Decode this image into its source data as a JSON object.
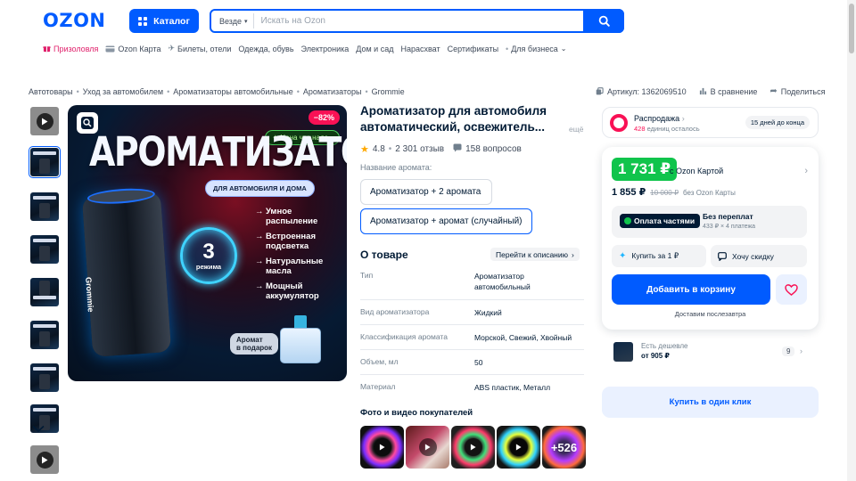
{
  "header": {
    "logo": "OZON",
    "catalog_label": "Каталог",
    "search_scope": "Везде",
    "search_placeholder": "Искать на Ozon"
  },
  "top_nav": [
    {
      "label": "Призоловля",
      "icon": "gift-icon"
    },
    {
      "label": "Ozon Карта",
      "icon": "card-icon"
    },
    {
      "label": "Билеты, отели",
      "icon": "plane-icon"
    },
    {
      "label": "Одежда, обувь"
    },
    {
      "label": "Электроника"
    },
    {
      "label": "Дом и сад"
    },
    {
      "label": "Нарасхват"
    },
    {
      "label": "Сертификаты"
    },
    {
      "label": "Для бизнеса"
    }
  ],
  "breadcrumbs": [
    "Автотовары",
    "Уход за автомобилем",
    "Ароматизаторы автомобильные",
    "Ароматизаторы",
    "Grommie"
  ],
  "product_meta": {
    "article": "Артикул: 1362069510",
    "compare": "В сравнение",
    "share": "Поделиться"
  },
  "gallery": {
    "discount_badge": "−82%",
    "good_price_badge": "Цена что надо",
    "title": "АРОМАТИЗАТОР",
    "usage_pill": "ДЛЯ АВТОМОБИЛЯ И ДОМА",
    "brand_on_device": "Grommie",
    "modes_number": "3",
    "modes_label": "режима",
    "features": [
      "Умное распыление",
      "Встроенная подсветка",
      "Натуральные масла",
      "Мощный аккумулятор"
    ],
    "gift_label": "Аромат\nв подарок"
  },
  "product": {
    "title": "Ароматизатор для автомобиля автоматический, освежитель...",
    "title_more": "ещё",
    "rating": "4.8",
    "reviews": "2 301 отзыв",
    "questions": "158 вопросов",
    "aroma_label": "Название аромата:",
    "options": [
      "Ароматизатор + 2 аромата",
      "Ароматизатор + аромат (случайный)"
    ],
    "selected_option": "Ароматизатор + аромат (случайный)"
  },
  "about": {
    "title": "О товаре",
    "link": "Перейти к описанию",
    "specs": [
      {
        "key": "Тип",
        "value": "Ароматизатор автомобильный"
      },
      {
        "key": "Вид ароматизатора",
        "value": "Жидкий"
      },
      {
        "key": "Классификация аромата",
        "value": "Морской, Свежий, Хвойный"
      },
      {
        "key": "Объем, мл",
        "value": "50"
      },
      {
        "key": "Материал",
        "value": "ABS пластик, Металл"
      }
    ]
  },
  "buyer_media": {
    "title": "Фото и видео покупателей",
    "more_count": "+526"
  },
  "sale": {
    "title": "Распродажа",
    "left_count": "428",
    "left_label": "единиц осталось",
    "timer": "15 дней до конца"
  },
  "pricing": {
    "ozon_card_price": "1 731 ₽",
    "ozon_card_label": "c Ozon Картой",
    "regular_price": "1 855 ₽",
    "old_price": "10 000 ₽",
    "regular_label": "без Ozon Карты",
    "installment_badge": "Оплата частями",
    "installment_title": "Без переплат",
    "installment_sub": "433 ₽ × 4 платежа",
    "buy_for_one": "Купить за 1 ₽",
    "want_discount": "Хочу скидку",
    "add_to_cart": "Добавить в корзину",
    "delivery": "Доставим послезавтра"
  },
  "cheaper": {
    "label": "Есть дешевле",
    "price": "от 905 ₽",
    "count": "9"
  },
  "one_click": "Купить в один клик",
  "colors": {
    "brand": "#005bff",
    "sale": "#f91155",
    "ozon_card_price": "#10c44c",
    "text": "#001a34"
  }
}
